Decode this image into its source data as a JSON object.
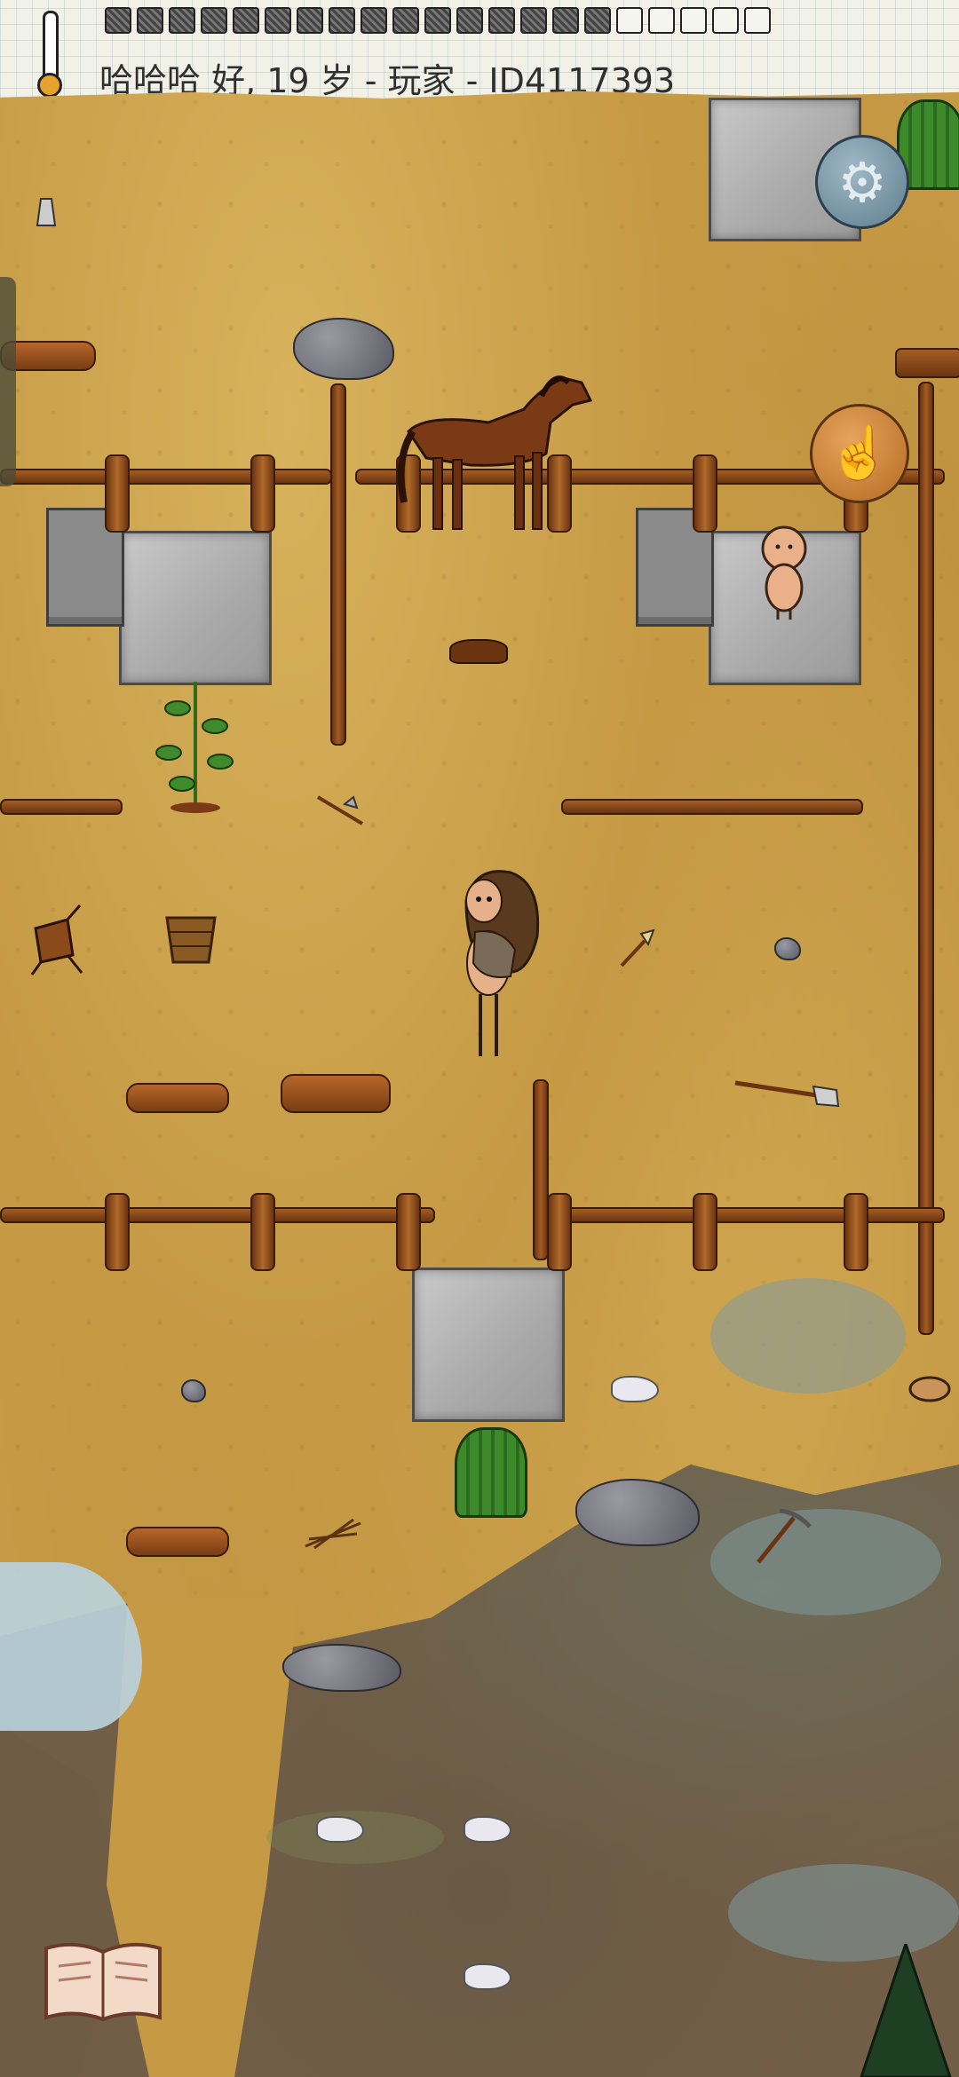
{
  "hud": {
    "player_line": "哈哈哈 好, 19 岁 - 玩家 - ID4117393",
    "food_pips_total": 21,
    "food_pips_filled": 16,
    "temperature_icon": "thermometer-icon"
  },
  "controls": {
    "settings_icon": "gear-icon",
    "use_icon": "pointing-hand-icon",
    "book_icon": "open-book-icon"
  },
  "colors": {
    "ground": "#c89d48",
    "fence": "#8b4a1a",
    "settings_button": "#6f8fa0",
    "hand_button": "#c97f34"
  }
}
